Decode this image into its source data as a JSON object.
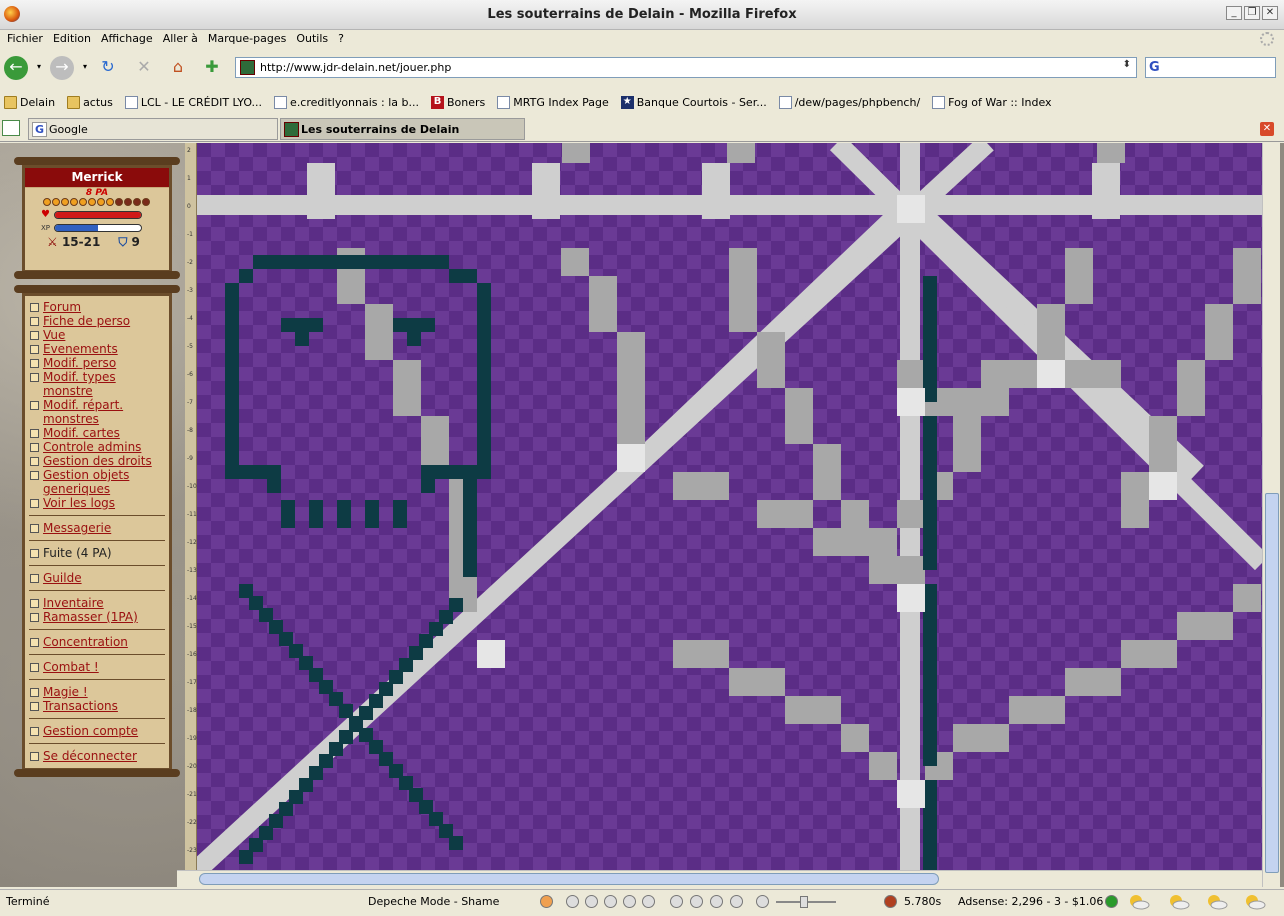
{
  "window": {
    "title": "Les souterrains de Delain - Mozilla Firefox"
  },
  "menu": [
    "Fichier",
    "Edition",
    "Affichage",
    "Aller à",
    "Marque-pages",
    "Outils",
    "?"
  ],
  "url": "http://www.jdr-delain.net/jouer.php",
  "bookmarks": [
    {
      "icon": "folder-icon",
      "label": "Delain"
    },
    {
      "icon": "folder-icon",
      "label": "actus"
    },
    {
      "icon": "page-icon",
      "label": "LCL - LE CRÉDIT LYO..."
    },
    {
      "icon": "page-icon",
      "label": "e.creditlyonnais : la b..."
    },
    {
      "icon": "blogger-icon",
      "label": "Boners"
    },
    {
      "icon": "page-icon",
      "label": "MRTG Index Page"
    },
    {
      "icon": "star-icon",
      "label": "Banque Courtois - Ser..."
    },
    {
      "icon": "page-icon",
      "label": "/dew/pages/phpbench/"
    },
    {
      "icon": "page-icon",
      "label": "Fog of War :: Index"
    }
  ],
  "tabs": [
    {
      "label": "Google",
      "active": false
    },
    {
      "label": "Les souterrains de Delain",
      "active": true
    }
  ],
  "character": {
    "name": "Merrick",
    "pa_label": "8 PA",
    "pa_current": 8,
    "pa_max": 12,
    "hp_fraction": 1.0,
    "xp_fraction": 0.5,
    "attack": "15-21",
    "armor": "9"
  },
  "menu_groups": [
    [
      {
        "label": "Forum",
        "link": true
      },
      {
        "label": "Fiche de perso",
        "link": true
      },
      {
        "label": "Vue",
        "link": true
      },
      {
        "label": "Evenements",
        "link": true
      },
      {
        "label": "Modif. perso",
        "link": true
      },
      {
        "label": "Modif. types monstre",
        "link": true
      },
      {
        "label": "Modif. répart. monstres",
        "link": true
      },
      {
        "label": "Modif. cartes",
        "link": true
      },
      {
        "label": "Controle admins",
        "link": true
      },
      {
        "label": "Gestion des droits",
        "link": true
      },
      {
        "label": "Gestion objets generiques",
        "link": true
      },
      {
        "label": "Voir les logs",
        "link": true
      }
    ],
    [
      {
        "label": "Messagerie",
        "link": true
      }
    ],
    [
      {
        "label": "Fuite (4 PA)",
        "link": false
      }
    ],
    [
      {
        "label": "Guilde",
        "link": true
      }
    ],
    [
      {
        "label": "Inventaire",
        "link": true
      },
      {
        "label": "Ramasser (1PA)",
        "link": true
      }
    ],
    [
      {
        "label": "Concentration",
        "link": true
      }
    ],
    [
      {
        "label": "Combat !",
        "link": true
      }
    ],
    [
      {
        "label": "Magie !",
        "link": true
      },
      {
        "label": "Transactions",
        "link": true
      }
    ],
    [
      {
        "label": "Gestion compte",
        "link": true
      }
    ],
    [
      {
        "label": "Se déconnecter",
        "link": true
      }
    ]
  ],
  "ruler_labels": [
    "2",
    "1",
    "0",
    "-1",
    "-2",
    "-3",
    "-4",
    "-5",
    "-6",
    "-7",
    "-8",
    "-9",
    "-10",
    "-11",
    "-12",
    "-13",
    "-14",
    "-15",
    "-16",
    "-17",
    "-18",
    "-19",
    "-20",
    "-21",
    "-22",
    "-23"
  ],
  "status": {
    "text": "Terminé",
    "track": "Depeche Mode - Shame",
    "timing": "5.780s",
    "adsense": "Adsense: 2,296 - 3 - $1.06"
  },
  "colors": {
    "map_purple": "#5b2d86",
    "map_purple_light": "#6a3a95",
    "wall_dark": "#0d3b44",
    "path_light": "#cfcfcf",
    "path_mid": "#a8a8a8",
    "title_red": "#8a0b0b"
  }
}
